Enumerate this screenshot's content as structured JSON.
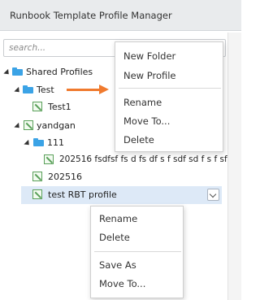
{
  "header": {
    "title": "Runbook Template Profile Manager"
  },
  "search": {
    "placeholder": "search..."
  },
  "tree": {
    "shared_profiles": "Shared Profiles",
    "test_folder": "Test",
    "test1": "Test1",
    "yandgan": "yandgan",
    "folder_111": "111",
    "long_profile": "202516 fsdfsf fs d fs df s f sdf sd f s f sf ...",
    "profile_202516": "202516",
    "selected_profile": "test RBT profile"
  },
  "folder_menu": {
    "new_folder": "New Folder",
    "new_profile": "New Profile",
    "rename": "Rename",
    "move_to": "Move To...",
    "delete": "Delete"
  },
  "profile_menu": {
    "rename": "Rename",
    "delete": "Delete",
    "save_as": "Save As",
    "move_to": "Move To..."
  },
  "colors": {
    "folder": "#3ba3e6",
    "profile": "#5aa05a",
    "selection": "#dde9f7",
    "arrow": "#f07a2e"
  }
}
